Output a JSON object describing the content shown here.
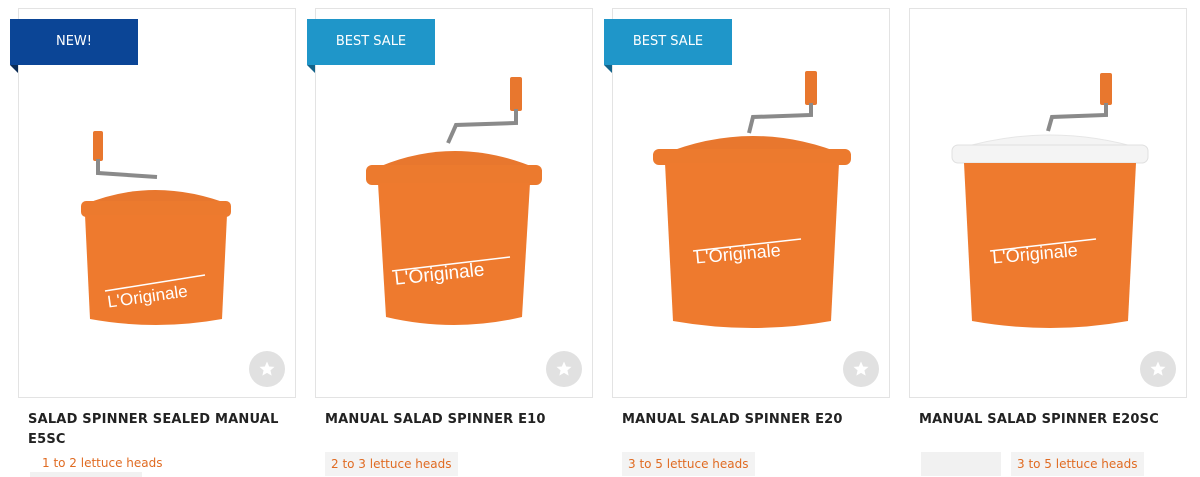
{
  "products": [
    {
      "ribbon": "NEW!",
      "title": "SALAD SPINNER SEALED MANUAL E5SC",
      "tag": "1 to 2 lettuce heads",
      "label": "L'Originale",
      "favorite_icon": "star-icon",
      "colors": {
        "body": "#ee7a2e",
        "lid": "#ec7a2e"
      }
    },
    {
      "ribbon": "BEST SALE",
      "title": "MANUAL SALAD SPINNER E10",
      "tag": "2 to 3 lettuce heads",
      "label": "L'Originale",
      "favorite_icon": "star-icon",
      "colors": {
        "body": "#ee7a2e",
        "lid": "#ec7a2e"
      }
    },
    {
      "ribbon": "BEST SALE",
      "title": "MANUAL SALAD SPINNER E20",
      "tag": "3 to 5 lettuce heads",
      "label": "L'Originale",
      "favorite_icon": "star-icon",
      "colors": {
        "body": "#ee7a2e",
        "lid": "#ec7a2e"
      }
    },
    {
      "ribbon": "",
      "title": "MANUAL SALAD SPINNER E20SC",
      "tag": "3 to 5 lettuce heads",
      "label": "L'Originale",
      "favorite_icon": "star-icon",
      "colors": {
        "body": "#ee7a2e",
        "lid": "#f4f4f4"
      }
    }
  ],
  "theme": {
    "ribbon_new": "#0b4596",
    "ribbon_sale": "#1f96c9",
    "tag_text": "#e06b22"
  }
}
